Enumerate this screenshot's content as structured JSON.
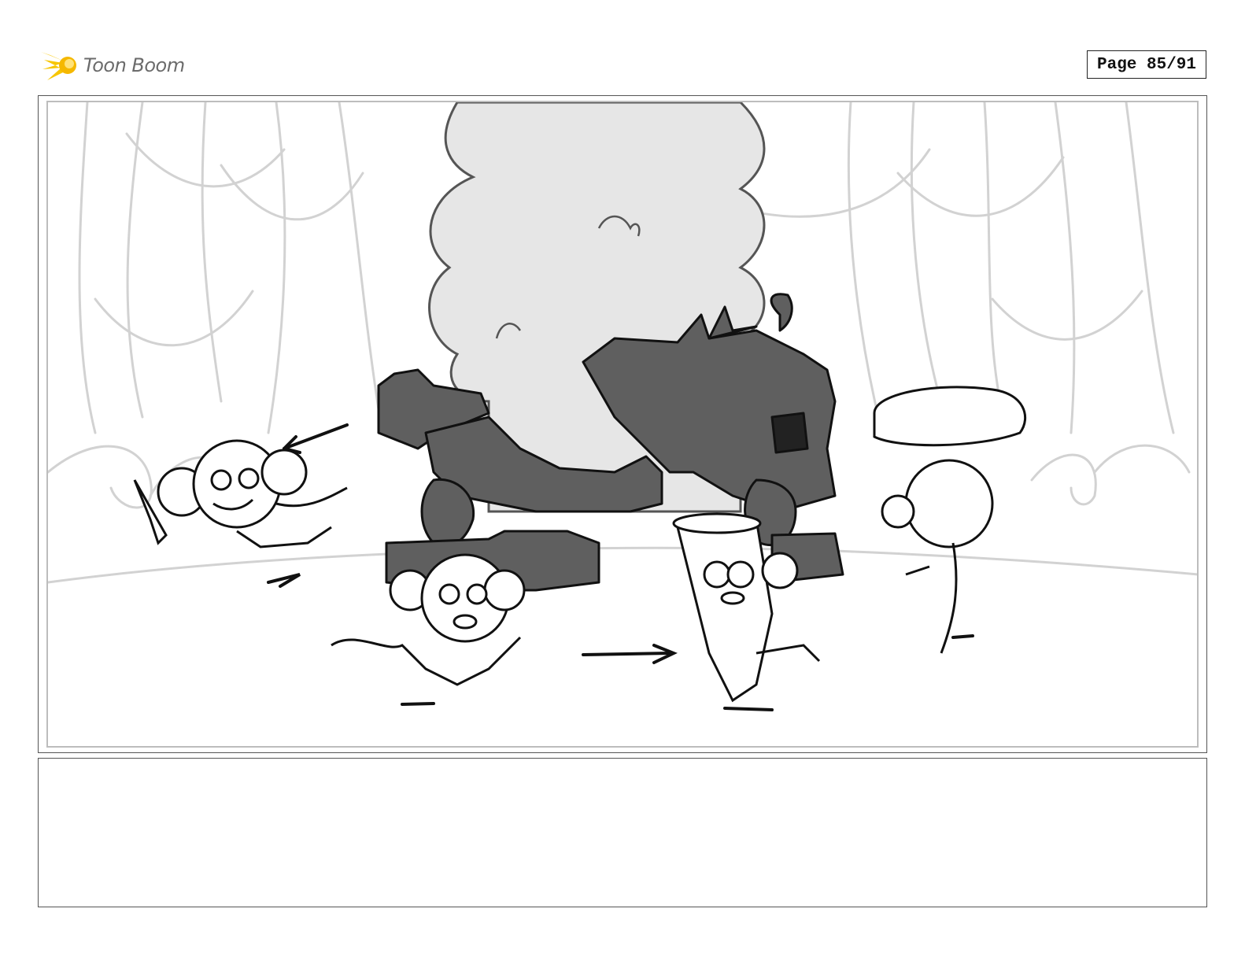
{
  "header": {
    "logo_text": "Toon Boom",
    "logo_icon": "comet-icon",
    "page_label": "Page 85/91"
  },
  "panel": {
    "icons": [
      "curtains-sketch",
      "smoke-cloud",
      "wrecked-vehicle",
      "monkey-character",
      "motion-arrow"
    ],
    "colors": {
      "wreck": "#5f5f5f",
      "smoke": "#e6e6e6",
      "curtain": "#d4d4d4",
      "ink": "#111111",
      "accent": "#f7c600"
    }
  },
  "caption": {
    "text": ""
  }
}
